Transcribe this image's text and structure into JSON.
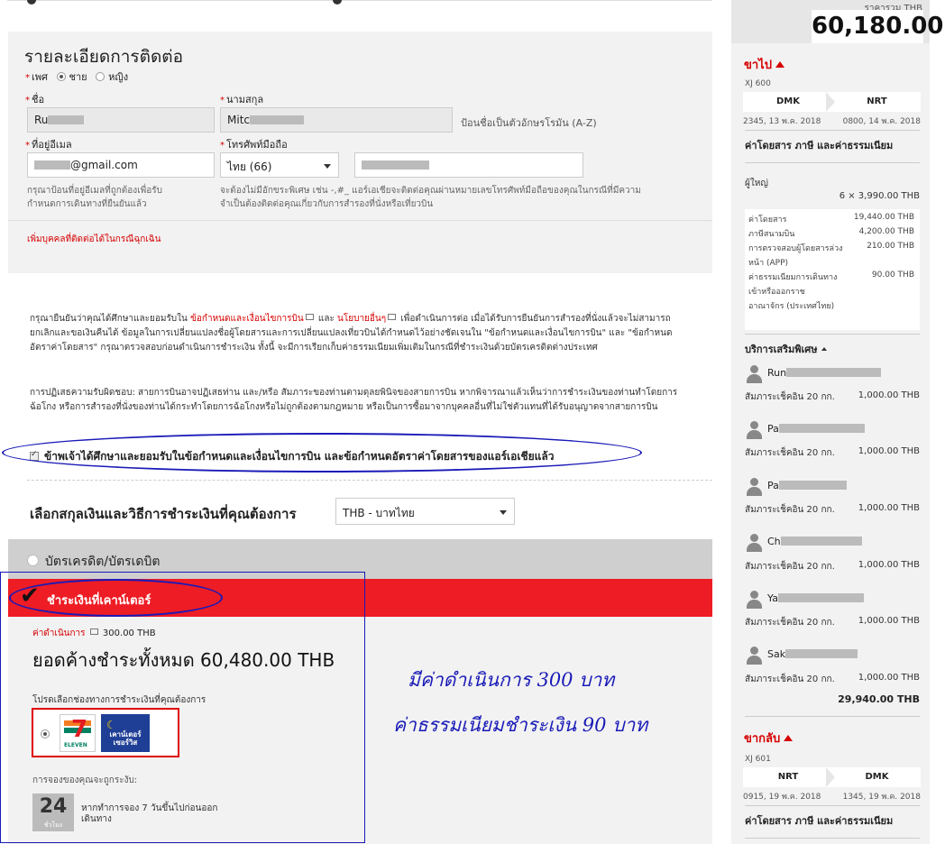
{
  "contact": {
    "title": "รายละเอียดการติดต่อ",
    "gender_label": "เพศ",
    "gender_male": "ชาย",
    "gender_female": "หญิง",
    "first_name_label": "ชื่อ",
    "first_name_value": "Ru",
    "last_name_label": "นามสกุล",
    "last_name_value": "Mitc",
    "name_hint": "ป้อนชื่อเป็นตัวอักษรโรมัน (A-Z)",
    "email_label": "ที่อยู่อีเมล",
    "email_value": "@gmail.com",
    "phone_label": "โทรศัพท์มือถือ",
    "phone_country": "ไทย (66)",
    "email_hint_1": "กรุณาป้อนที่อยู่อีเมลที่ถูกต้องเพื่อรับ",
    "email_hint_2": "กำหนดการเดินทางที่ยืนยันแล้ว",
    "phone_hint_1": "จะต้องไม่มีอักขระพิเศษ เช่น -,#_ แอร์เอเชียจะติดต่อคุณผ่านหมายเลขโทรศัพท์มือถือของคุณในกรณีที่มีความ",
    "phone_hint_2": "จำเป็นต้องติดต่อคุณเกี่ยวกับการสำรองที่นั่งหรือเที่ยวบิน",
    "emergency_link": "เพิ่มบุคคลที่ติดต่อได้ในกรณีฉุกเฉิน"
  },
  "terms": {
    "p1_a": "กรุณายืนยันว่าคุณได้ศึกษาและยอมรับใน",
    "p1_link1": "ข้อกำหนดและเงื่อนไขการบิน",
    "p1_b": "และ",
    "p1_link2": "นโยบายอื่นๆ",
    "p1_c": "เพื่อดำเนินการต่อ เมื่อได้รับการยืนยันการสำรองที่นั่งแล้วจะไม่สามารถยกเลิกและขอเงินคืนได้ ข้อมูลในการเปลี่ยนแปลงชื่อผู้โดยสารและการเปลี่ยนแปลงเที่ยวบินได้กำหนดไว้อย่างชัดเจนใน \"ข้อกำหนดและเงื่อนไขการบิน\" และ \"ข้อกำหนดอัตราค่าโดยสาร\" กรุณาตรวจสอบก่อนดำเนินการชำระเงิน ทั้งนี้ จะมีการเรียกเก็บค่าธรรมเนียมเพิ่มเติมในกรณีที่ชำระเงินด้วยบัตรเครดิตต่างประเทศ",
    "p2": "การปฏิเสธความรับผิดชอบ: สายการบินอาจปฏิเสธท่าน และ/หรือ สัมภาระของท่านตามดุลยพินิจของสายการบิน หากพิจารณาแล้วเห็นว่าการชำระเงินของท่านทำโดยการฉ้อโกง หรือการสำรองที่นั่งของท่านได้กระทำโดยการฉ้อโกงหรือไม่ถูกต้องตามกฎหมาย หรือเป็นการซื้อมาจากบุคคลอื่นที่ไม่ใช่ตัวแทนที่ได้รับอนุญาตจากสายการบิน",
    "agree": "ข้าพเจ้าได้ศึกษาและยอมรับในข้อกำหนดและเงื่อนไขการบิน และข้อกำหนดอัตราค่าโดยสารของแอร์เอเชียแล้ว"
  },
  "currency": {
    "title": "เลือกสกุลเงินและวิธีการชำระเงินที่คุณต้องการ",
    "selected": "THB - บาทไทย"
  },
  "payment": {
    "card_label": "บัตรเครดิต/บัตรเดบิต",
    "counter_label": "ชำระเงินที่เคาน์เตอร์",
    "fee_label": "ค่าดำเนินการ",
    "fee_value": "300.00 THB",
    "total_label": "ยอดค้างชำระทั้งหมด",
    "total_value": "60,480.00 THB",
    "channel_label": "โปรดเลือกช่องทางการชำระเงินที่คุณต้องการ",
    "logo_711_num": "7",
    "logo_711_text": "ELEVEN",
    "logo_cp_text": "เคาน์เตอร์ เซอร์วิส",
    "confirm_label": "การจองของคุณจะถูกระงับ:",
    "hours_num": "24",
    "hours_unit": "ชั่วโมง",
    "hours_text": "หากทำการจอง 7 วันขึ้นไปก่อนออกเดินทาง"
  },
  "annotations": {
    "a1": "มีค่าดำเนินการ 300 บาท",
    "a2": "ค่าธรรมเนียมชำระเงิน 90 บาท"
  },
  "sidebar": {
    "price_label": "ราคารวม THB",
    "price_value": "60,180.00",
    "outbound": {
      "title": "ขาไป",
      "flight": "XJ 600",
      "from": "DMK",
      "to": "NRT",
      "dep": "2345, 13 พ.ค. 2018",
      "arr": "0800, 14 พ.ค. 2018",
      "fare_title": "ค่าโดยสาร ภาษี และค่าธรรมเนียม",
      "adult": "ผู้ใหญ่",
      "adult_calc": "6 × 3,990.00 THB",
      "fees": [
        {
          "label": "ค่าโดยสาร",
          "amount": "19,440.00 THB"
        },
        {
          "label": "ภาษีสนามบิน",
          "amount": "4,200.00 THB"
        },
        {
          "label": "การตรวจสอบผู้โดยสารล่วงหน้า (APP)",
          "amount": "210.00 THB"
        },
        {
          "label": "ค่าธรรมเนียมการเดินทางเข้าหรือออกราชอาณาจักร (ประเทศไทย)",
          "amount": "90.00 THB"
        }
      ],
      "extras_title": "บริการเสริมพิเศษ",
      "passengers": [
        {
          "name": "Run",
          "item": "สัมภาระเช็คอิน 20 กก.",
          "amount": "1,000.00 THB"
        },
        {
          "name": "Pa",
          "item": "สัมภาระเช็คอิน 20 กก.",
          "amount": "1,000.00 THB"
        },
        {
          "name": "Pa",
          "item": "สัมภาระเช็คอิน 20 กก.",
          "amount": "1,000.00 THB"
        },
        {
          "name": "Ch",
          "item": "สัมภาระเช็คอิน 20 กก.",
          "amount": "1,000.00 THB"
        },
        {
          "name": "Ya",
          "item": "สัมภาระเช็คอิน 20 กก.",
          "amount": "1,000.00 THB"
        },
        {
          "name": "Sak",
          "item": "สัมภาระเช็คอิน 20 กก.",
          "amount": "1,000.00 THB"
        }
      ],
      "subtotal": "29,940.00 THB"
    },
    "return": {
      "title": "ขากลับ",
      "flight": "XJ 601",
      "from": "NRT",
      "to": "DMK",
      "dep": "0915, 19 พ.ค. 2018",
      "arr": "1345, 19 พ.ค. 2018",
      "fare_title": "ค่าโดยสาร ภาษี และค่าธรรมเนียม"
    }
  },
  "colors": {
    "brand_red": "#ee1c24",
    "link_red": "#d60000",
    "annotation_blue": "#1a1ab8",
    "panel_gray": "#f2f2f2"
  }
}
